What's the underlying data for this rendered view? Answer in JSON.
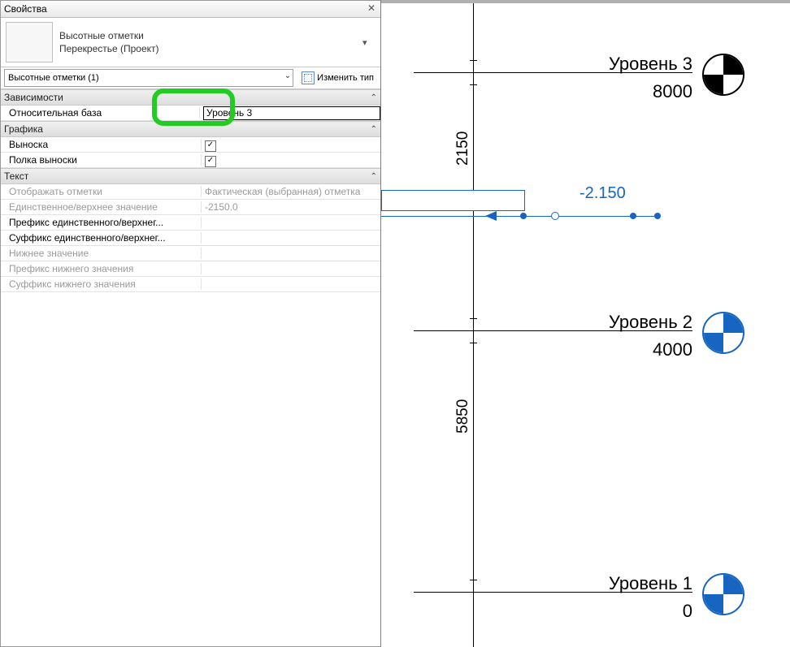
{
  "palette": {
    "title": "Свойства",
    "type_line1": "Высотные отметки",
    "type_line2": "Перекрестье (Проект)",
    "instance_filter": "Высотные отметки (1)",
    "edit_type": "Изменить тип",
    "groups": {
      "deps": "Зависимости",
      "graphics": "Графика",
      "text": "Текст"
    },
    "rows": {
      "rel_base_name": "Относительная база",
      "rel_base_value": "Уровень 3",
      "leader_name": "Выноска",
      "leader_shoulder_name": "Полка выноски",
      "display_elevations_name": "Отображать отметки",
      "display_elevations_value": "Фактическая (выбранная) отметка",
      "single_upper_name": "Единственное/верхнее значение",
      "single_upper_value": "-2150.0",
      "single_upper_prefix": "Префикс единственного/верхнег...",
      "single_upper_suffix": "Суффикс единственного/верхнег...",
      "lower_value_name": "Нижнее значение",
      "lower_prefix": "Префикс нижнего значения",
      "lower_suffix": "Суффикс нижнего значения"
    }
  },
  "canvas": {
    "level3_name": "Уровень 3",
    "level3_elev": "8000",
    "level2_name": "Уровень 2",
    "level2_elev": "4000",
    "level1_name": "Уровень 1",
    "level1_elev": "0",
    "dim_upper": "2150",
    "dim_lower": "5850",
    "spot_value": "-2.150"
  }
}
